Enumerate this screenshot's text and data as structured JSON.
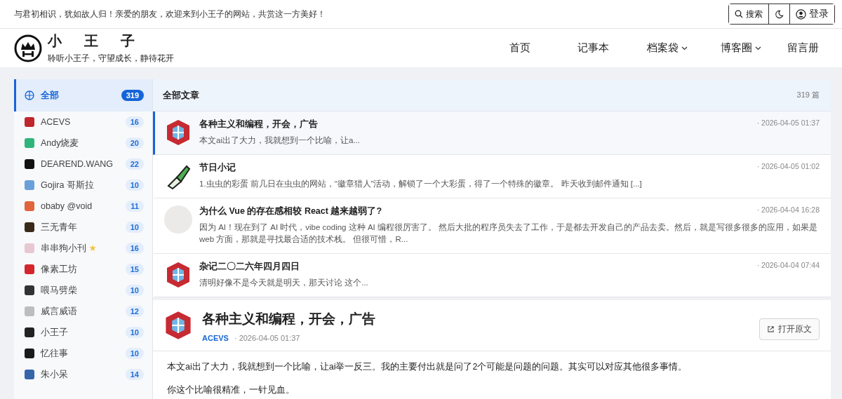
{
  "top_bar": {
    "greeting": "与君初相识，犹如故人归！亲爱的朋友，欢迎来到小王子的网站，共赏这一方美好！",
    "search_label": "搜索",
    "login_label": "登录"
  },
  "header": {
    "title": "小王子",
    "subtitle": "聆听小王子，守望成长，静待花开",
    "nav": [
      {
        "label": "首页",
        "dropdown": false
      },
      {
        "label": "记事本",
        "dropdown": false
      },
      {
        "label": "档案袋",
        "dropdown": true
      },
      {
        "label": "博客圈",
        "dropdown": true
      },
      {
        "label": "留言册",
        "dropdown": false
      }
    ]
  },
  "sidebar": {
    "items": [
      {
        "kind": "all",
        "name": "全部",
        "count": "319",
        "selected": true
      },
      {
        "kind": "site",
        "name": "ACEVS",
        "count": "16",
        "selected": false
      },
      {
        "kind": "site",
        "name": "Andy烧麦",
        "count": "20",
        "selected": false
      },
      {
        "kind": "site",
        "name": "DEAREND.WANG",
        "count": "22",
        "selected": false
      },
      {
        "kind": "site",
        "name": "Gojira 哥斯拉",
        "count": "10",
        "selected": false
      },
      {
        "kind": "site",
        "name": "obaby @void",
        "count": "11",
        "selected": false
      },
      {
        "kind": "site",
        "name": "三无青年",
        "count": "10",
        "selected": false
      },
      {
        "kind": "site",
        "name": "串串狗小刊",
        "mark": "★",
        "count": "16",
        "selected": false
      },
      {
        "kind": "site",
        "name": "像素工坊",
        "count": "15",
        "selected": false
      },
      {
        "kind": "site",
        "name": "喂马劈柴",
        "count": "10",
        "selected": false
      },
      {
        "kind": "site",
        "name": "威言威语",
        "count": "12",
        "selected": false
      },
      {
        "kind": "site",
        "name": "小王子",
        "count": "10",
        "selected": false
      },
      {
        "kind": "site",
        "name": "忆往事",
        "count": "10",
        "selected": false
      },
      {
        "kind": "site",
        "name": "朱小呆",
        "count": "14",
        "selected": false
      }
    ]
  },
  "post_list": {
    "title": "全部文章",
    "count": "319 篇",
    "posts": [
      {
        "title": "各种主义和编程，开会，广告",
        "excerpt": "本文ai出了大力，我就想到一个比喻，让a...",
        "date": "· 2026-04-05 01:37",
        "selected": true
      },
      {
        "title": "节日小记",
        "excerpt": "1.虫虫的彩蛋 前几日在虫虫的网站，“徽章猎人”活动，解锁了一个大彩蛋，得了一个特殊的徽章。 昨天收到邮件通知 [...]",
        "date": "· 2026-04-05 01:02",
        "selected": false
      },
      {
        "title": "为什么 Vue 的存在感相较 React 越来越弱了?",
        "excerpt": "因为 AI！现在到了 AI 时代，vibe coding 这种 AI 编程很厉害了。 然后大批的程序员失去了工作，于是都去开发自己的产品去卖。然后，就是写很多很多的应用，如果是 web 方面，那就是寻找最合适的技术栈。 但很可惜，R...",
        "date": "· 2026-04-04 16:28",
        "selected": false
      },
      {
        "title": "杂记二〇二六年四月四日",
        "excerpt": "清明好像不是今天就是明天，那天讨论 这个...",
        "date": "· 2026-04-04 07:44",
        "selected": false
      }
    ]
  },
  "article": {
    "title": "各种主义和编程，开会，广告",
    "author": "ACEVS",
    "date": "· 2026-04-05 01:37",
    "open_button": "打开原文",
    "paragraphs": [
      "本文ai出了大力，我就想到一个比喻，让ai举一反三。我的主要付出就是问了2个可能是问题的问题。其实可以对应其他很多事情。",
      "你这个比喻很精准，一针见血。"
    ]
  }
}
